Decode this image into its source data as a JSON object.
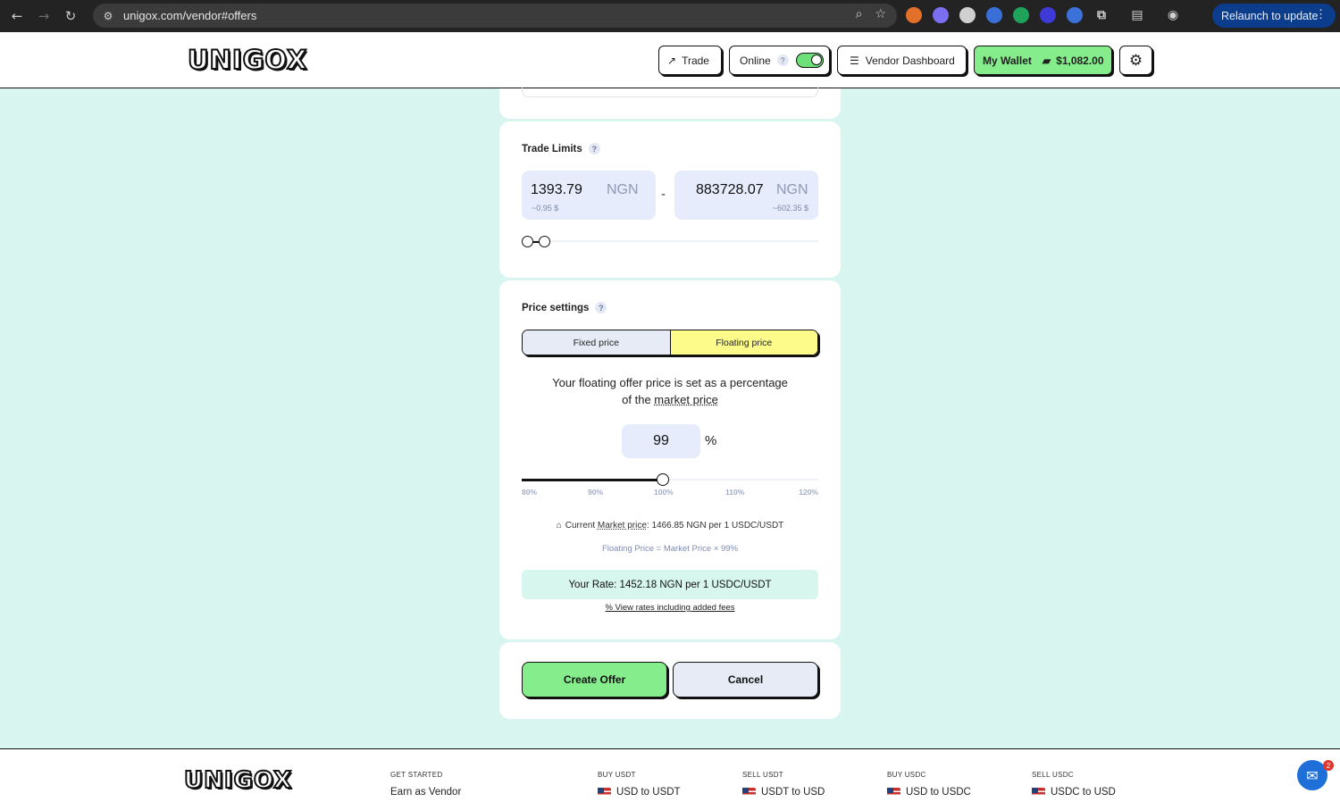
{
  "browser": {
    "url": "unigox.com/vendor#offers",
    "relaunch_label": "Relaunch to update",
    "extension_colors": [
      "#e2702a",
      "#7c6ef0",
      "#d0d0d0",
      "#3a6fd8",
      "#1fa35a",
      "#3d3ad8",
      "#3b71d8"
    ]
  },
  "header": {
    "logo_text": "UNIGOX",
    "trade_label": "Trade",
    "online_label": "Online",
    "online_help": "?",
    "online_enabled": true,
    "vendor_dashboard_label": "Vendor Dashboard",
    "wallet_label": "My Wallet",
    "wallet_balance": "$1,082.00"
  },
  "trade_limits": {
    "title": "Trade Limits",
    "help": "?",
    "min_amount": "1393.79",
    "min_currency": "NGN",
    "min_usd": "~0.95 $",
    "separator": "-",
    "max_amount": "883728.07",
    "max_currency": "NGN",
    "max_usd": "~602.35 $"
  },
  "price_settings": {
    "title": "Price settings",
    "help": "?",
    "fixed_label": "Fixed price",
    "floating_label": "Floating price",
    "selected": "floating",
    "desc_line1": "Your floating offer price is set as a percentage",
    "desc_prefix": "of the ",
    "desc_link": "market price",
    "percentage": "99",
    "percent_sign": "%",
    "slider_min": 80,
    "slider_max": 120,
    "slider_value": 99,
    "ticks": [
      "80%",
      "90%",
      "100%",
      "110%",
      "120%"
    ],
    "market_prefix": "Current ",
    "market_link": "Market price",
    "market_value": ": 1466.85 NGN per 1 USDC/USDT",
    "formula": "Floating Price = Market Price × 99%",
    "your_rate": "Your Rate: 1452.18 NGN per 1 USDC/USDT",
    "view_rates": "% View rates including added fees"
  },
  "actions": {
    "create_label": "Create Offer",
    "cancel_label": "Cancel"
  },
  "footer": {
    "logo_text": "UNIGOX",
    "columns": [
      {
        "heading": "GET STARTED",
        "link": "Earn as Vendor"
      },
      {
        "heading": "BUY USDT",
        "link": "USD to USDT"
      },
      {
        "heading": "SELL USDT",
        "link": "USDT to USD"
      },
      {
        "heading": "BUY USDC",
        "link": "USD to USDC"
      },
      {
        "heading": "SELL USDC",
        "link": "USDC to USD"
      }
    ],
    "chat_badge": "2"
  }
}
